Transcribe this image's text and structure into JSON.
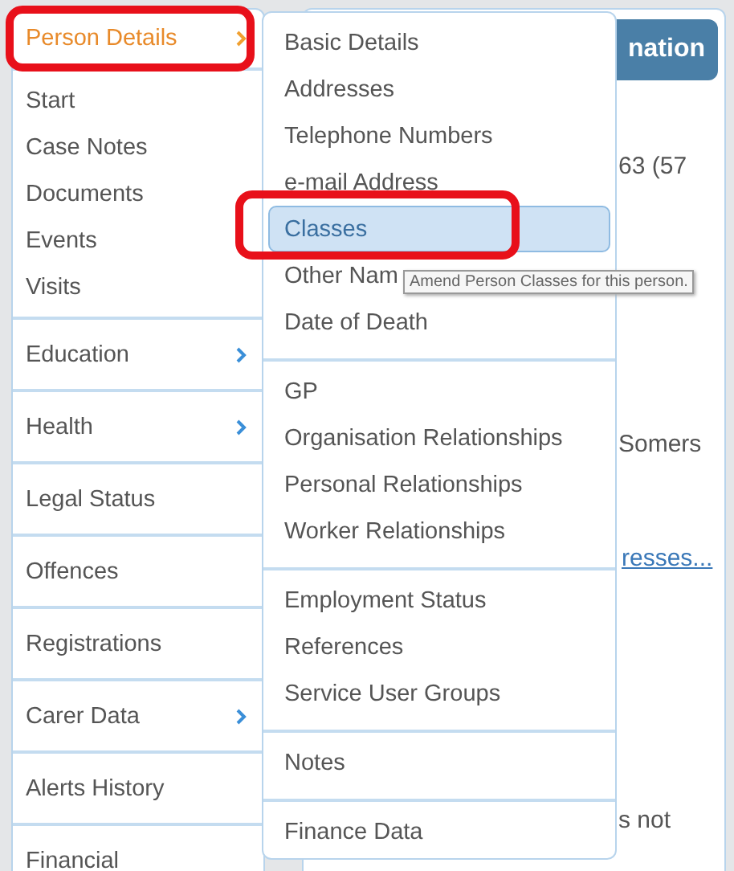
{
  "background_page": {
    "header": "nation",
    "texts": [
      {
        "kind": "text",
        "text": "63 (57"
      },
      {
        "kind": "text",
        "text": "Somers"
      },
      {
        "kind": "link",
        "text": "resses..."
      },
      {
        "kind": "text",
        "text": "s not"
      }
    ]
  },
  "main_menu": {
    "groups": [
      {
        "items": [
          {
            "label": "Person Details",
            "selected": true,
            "submenu": true
          }
        ]
      },
      {
        "items": [
          {
            "label": "Start",
            "selected": false,
            "submenu": false
          },
          {
            "label": "Case Notes",
            "selected": false,
            "submenu": false
          },
          {
            "label": "Documents",
            "selected": false,
            "submenu": false
          },
          {
            "label": "Events",
            "selected": false,
            "submenu": false
          },
          {
            "label": "Visits",
            "selected": false,
            "submenu": false
          }
        ]
      },
      {
        "items": [
          {
            "label": "Education",
            "selected": false,
            "submenu": true
          }
        ]
      },
      {
        "items": [
          {
            "label": "Health",
            "selected": false,
            "submenu": true
          }
        ]
      },
      {
        "items": [
          {
            "label": "Legal Status",
            "selected": false,
            "submenu": false
          }
        ]
      },
      {
        "items": [
          {
            "label": "Offences",
            "selected": false,
            "submenu": false
          }
        ]
      },
      {
        "items": [
          {
            "label": "Registrations",
            "selected": false,
            "submenu": false
          }
        ]
      },
      {
        "items": [
          {
            "label": "Carer Data",
            "selected": false,
            "submenu": true
          }
        ]
      },
      {
        "items": [
          {
            "label": "Alerts History",
            "selected": false,
            "submenu": false
          }
        ]
      },
      {
        "items": [
          {
            "label": "Financial",
            "selected": false,
            "submenu": false
          }
        ]
      }
    ]
  },
  "submenu": {
    "groups": [
      {
        "items": [
          {
            "label": "Basic Details",
            "selected": false
          },
          {
            "label": "Addresses",
            "selected": false
          },
          {
            "label": "Telephone Numbers",
            "selected": false
          },
          {
            "label": "e-mail Address",
            "selected": false
          },
          {
            "label": "Classes",
            "selected": true
          },
          {
            "label": "Other Nam",
            "selected": false
          },
          {
            "label": "Date of Death",
            "selected": false
          }
        ]
      },
      {
        "items": [
          {
            "label": "GP",
            "selected": false
          },
          {
            "label": "Organisation Relationships",
            "selected": false
          },
          {
            "label": "Personal Relationships",
            "selected": false
          },
          {
            "label": "Worker Relationships",
            "selected": false
          }
        ]
      },
      {
        "items": [
          {
            "label": "Employment Status",
            "selected": false
          },
          {
            "label": "References",
            "selected": false
          },
          {
            "label": "Service User Groups",
            "selected": false
          }
        ]
      },
      {
        "items": [
          {
            "label": "Notes",
            "selected": false
          }
        ]
      },
      {
        "items": [
          {
            "label": "Finance Data",
            "selected": false
          }
        ]
      }
    ],
    "tooltip": "Amend Person Classes for this person."
  }
}
